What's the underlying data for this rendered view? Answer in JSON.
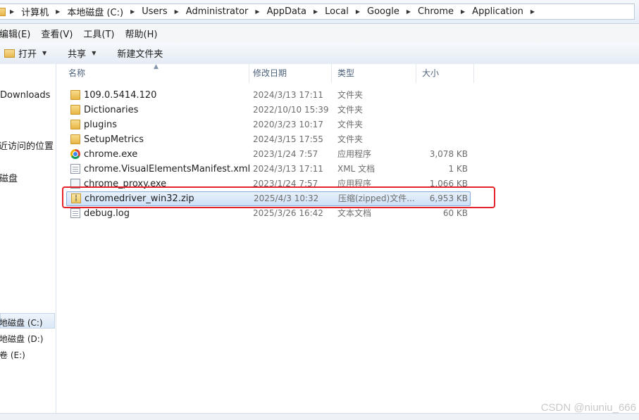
{
  "address_bar": {
    "crumbs": [
      "计算机",
      "本地磁盘 (C:)",
      "Users",
      "Administrator",
      "AppData",
      "Local",
      "Google",
      "Chrome",
      "Application"
    ]
  },
  "menubar": {
    "items": [
      "编辑(E)",
      "查看(V)",
      "工具(T)",
      "帮助(H)"
    ]
  },
  "toolbar": {
    "open_label": "打开",
    "share_label": "共享",
    "new_folder_label": "新建文件夹"
  },
  "nav": {
    "items": [
      "Downloads",
      "最近访问的位置",
      "本地磁盘",
      "本地磁盘 (C:)",
      "本地磁盘 (D:)",
      "新加卷 (E:)"
    ]
  },
  "columns": {
    "name": "名称",
    "date": "修改日期",
    "type": "类型",
    "size": "大小"
  },
  "files": [
    {
      "name": "109.0.5414.120",
      "date": "2024/3/13 17:11",
      "type": "文件夹",
      "size": "",
      "icon": "folder-icon"
    },
    {
      "name": "Dictionaries",
      "date": "2022/10/10 15:39",
      "type": "文件夹",
      "size": "",
      "icon": "folder-icon"
    },
    {
      "name": "plugins",
      "date": "2020/3/23 10:17",
      "type": "文件夹",
      "size": "",
      "icon": "folder-icon"
    },
    {
      "name": "SetupMetrics",
      "date": "2024/3/15 17:55",
      "type": "文件夹",
      "size": "",
      "icon": "folder-icon"
    },
    {
      "name": "chrome.exe",
      "date": "2023/1/24 7:57",
      "type": "应用程序",
      "size": "3,078 KB",
      "icon": "chrome-icon"
    },
    {
      "name": "chrome.VisualElementsManifest.xml",
      "date": "2024/3/13 17:11",
      "type": "XML 文档",
      "size": "1 KB",
      "icon": "xml-file-icon"
    },
    {
      "name": "chrome_proxy.exe",
      "date": "2023/1/24 7:57",
      "type": "应用程序",
      "size": "1,066 KB",
      "icon": "exe-file-icon"
    },
    {
      "name": "chromedriver_win32.zip",
      "date": "2025/4/3 10:32",
      "type": "压缩(zipped)文件...",
      "size": "6,953 KB",
      "icon": "zip-file-icon"
    },
    {
      "name": "debug.log",
      "date": "2025/3/26 16:42",
      "type": "文本文档",
      "size": "60 KB",
      "icon": "text-file-icon"
    }
  ],
  "watermark": "CSDN @niuniu_666",
  "colors": {
    "highlight_border": "#e5232a",
    "selection_border": "#84acdd",
    "header_text": "#4c607a"
  }
}
